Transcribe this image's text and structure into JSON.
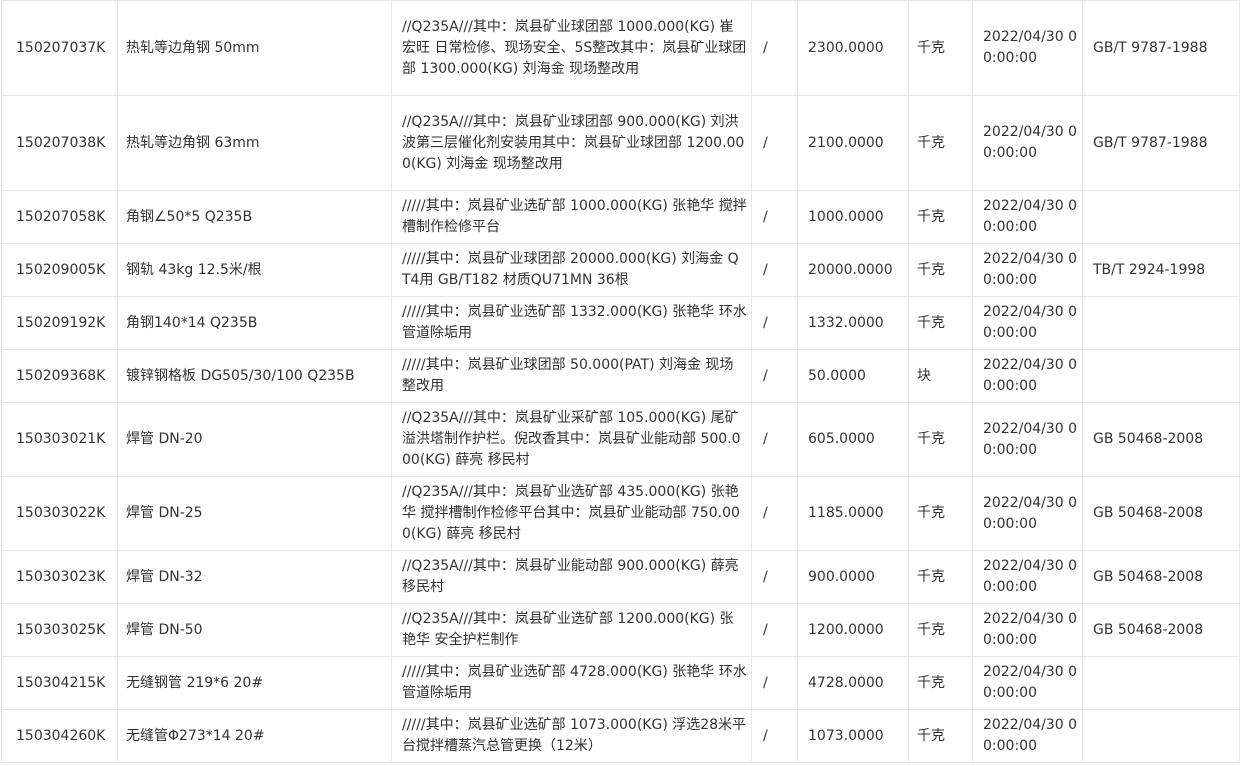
{
  "rows": [
    {
      "code": "150207037K",
      "name": "热轧等边角钢 50mm",
      "note": "//Q235A///其中：岚县矿业球团部 1000.000(KG) 崔宏旺 日常检修、现场安全、5S整改其中：岚县矿业球团部 1300.000(KG) 刘海金 现场整改用",
      "slash": "/",
      "qty": "2300.0000",
      "unit": "千克",
      "date": "2022/04/30 00:00:00",
      "std": "GB/T 9787-1988"
    },
    {
      "code": "150207038K",
      "name": "热轧等边角钢 63mm",
      "note": "//Q235A///其中：岚县矿业球团部 900.000(KG) 刘洪波第三层催化剂安装用其中：岚县矿业球团部 1200.000(KG) 刘海金 现场整改用",
      "slash": "/",
      "qty": "2100.0000",
      "unit": "千克",
      "date": "2022/04/30 00:00:00",
      "std": "GB/T 9787-1988"
    },
    {
      "code": "150207058K",
      "name": "角钢∠50*5 Q235B",
      "note": "/////其中：岚县矿业选矿部 1000.000(KG) 张艳华 搅拌槽制作检修平台",
      "slash": "/",
      "qty": "1000.0000",
      "unit": "千克",
      "date": "2022/04/30 00:00:00",
      "std": ""
    },
    {
      "code": "150209005K",
      "name": "钢轨 43kg 12.5米/根",
      "note": "/////其中：岚县矿业球团部 20000.000(KG) 刘海金 QT4用 GB/T182 材质QU71MN 36根",
      "slash": "/",
      "qty": "20000.0000",
      "unit": "千克",
      "date": "2022/04/30 00:00:00",
      "std": "TB/T 2924-1998"
    },
    {
      "code": "150209192K",
      "name": "角钢140*14 Q235B",
      "note": "/////其中：岚县矿业选矿部 1332.000(KG) 张艳华 环水管道除垢用",
      "slash": "/",
      "qty": "1332.0000",
      "unit": "千克",
      "date": "2022/04/30 00:00:00",
      "std": ""
    },
    {
      "code": "150209368K",
      "name": "镀锌钢格板 DG505/30/100 Q235B",
      "note": "/////其中：岚县矿业球团部 50.000(PAT) 刘海金 现场整改用",
      "slash": "/",
      "qty": "50.0000",
      "unit": "块",
      "date": "2022/04/30 00:00:00",
      "std": ""
    },
    {
      "code": "150303021K",
      "name": "焊管 DN-20",
      "note": "//Q235A///其中：岚县矿业采矿部 105.000(KG) 尾矿溢洪塔制作护栏。倪改香其中：岚县矿业能动部 500.000(KG) 薛亮 移民村",
      "slash": "/",
      "qty": "605.0000",
      "unit": "千克",
      "date": "2022/04/30 00:00:00",
      "std": "GB 50468-2008"
    },
    {
      "code": "150303022K",
      "name": "焊管 DN-25",
      "note": "//Q235A///其中：岚县矿业选矿部 435.000(KG) 张艳华 搅拌槽制作检修平台其中：岚县矿业能动部 750.000(KG) 薛亮 移民村",
      "slash": "/",
      "qty": "1185.0000",
      "unit": "千克",
      "date": "2022/04/30 00:00:00",
      "std": "GB 50468-2008"
    },
    {
      "code": "150303023K",
      "name": "焊管 DN-32",
      "note": "//Q235A///其中：岚县矿业能动部 900.000(KG) 薛亮 移民村",
      "slash": "/",
      "qty": "900.0000",
      "unit": "千克",
      "date": "2022/04/30 00:00:00",
      "std": "GB 50468-2008"
    },
    {
      "code": "150303025K",
      "name": "焊管 DN-50",
      "note": "//Q235A///其中：岚县矿业选矿部 1200.000(KG) 张艳华 安全护栏制作",
      "slash": "/",
      "qty": "1200.0000",
      "unit": "千克",
      "date": "2022/04/30 00:00:00",
      "std": "GB 50468-2008"
    },
    {
      "code": "150304215K",
      "name": "无缝钢管 219*6 20#",
      "note": "/////其中：岚县矿业选矿部 4728.000(KG) 张艳华 环水管道除垢用",
      "slash": "/",
      "qty": "4728.0000",
      "unit": "千克",
      "date": "2022/04/30 00:00:00",
      "std": ""
    },
    {
      "code": "150304260K",
      "name": "无缝管Φ273*14 20#",
      "note": "/////其中：岚县矿业选矿部 1073.000(KG) 浮选28米平台搅拌槽蒸汽总管更换（12米）",
      "slash": "/",
      "qty": "1073.0000",
      "unit": "千克",
      "date": "2022/04/30 00:00:00",
      "std": ""
    }
  ]
}
